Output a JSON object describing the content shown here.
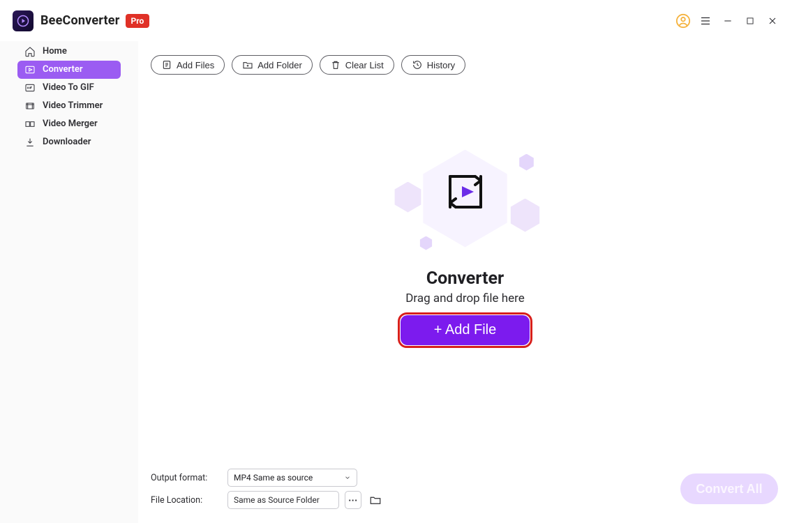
{
  "app": {
    "title": "BeeConverter",
    "badge": "Pro"
  },
  "titlebar_icons": {
    "avatar": "avatar-icon",
    "menu": "menu-icon",
    "minimize": "minimize-icon",
    "maximize": "maximize-icon",
    "close": "close-icon"
  },
  "sidebar": {
    "items": [
      {
        "id": "home",
        "label": "Home",
        "icon": "home-icon",
        "active": false
      },
      {
        "id": "converter",
        "label": "Converter",
        "icon": "converter-icon",
        "active": true
      },
      {
        "id": "video-to-gif",
        "label": "Video To GIF",
        "icon": "gif-icon",
        "active": false
      },
      {
        "id": "video-trimmer",
        "label": "Video Trimmer",
        "icon": "trimmer-icon",
        "active": false
      },
      {
        "id": "video-merger",
        "label": "Video Merger",
        "icon": "merger-icon",
        "active": false
      },
      {
        "id": "downloader",
        "label": "Downloader",
        "icon": "downloader-icon",
        "active": false
      }
    ]
  },
  "toolbar": {
    "add_files": "Add Files",
    "add_folder": "Add Folder",
    "clear_list": "Clear List",
    "history": "History"
  },
  "dropzone": {
    "title": "Converter",
    "subtitle": "Drag and drop file here",
    "button": "+ Add File"
  },
  "footer": {
    "output_format_label": "Output format:",
    "output_format_value": "MP4 Same as source",
    "file_location_label": "File Location:",
    "file_location_value": "Same as Source Folder",
    "dots": "···",
    "convert_all": "Convert All"
  },
  "colors": {
    "accent": "#7c1bee",
    "accent_light": "#9b5cf2",
    "highlight_ring": "#d81f1c",
    "badge": "#e03127",
    "avatar": "#f5b33f"
  }
}
